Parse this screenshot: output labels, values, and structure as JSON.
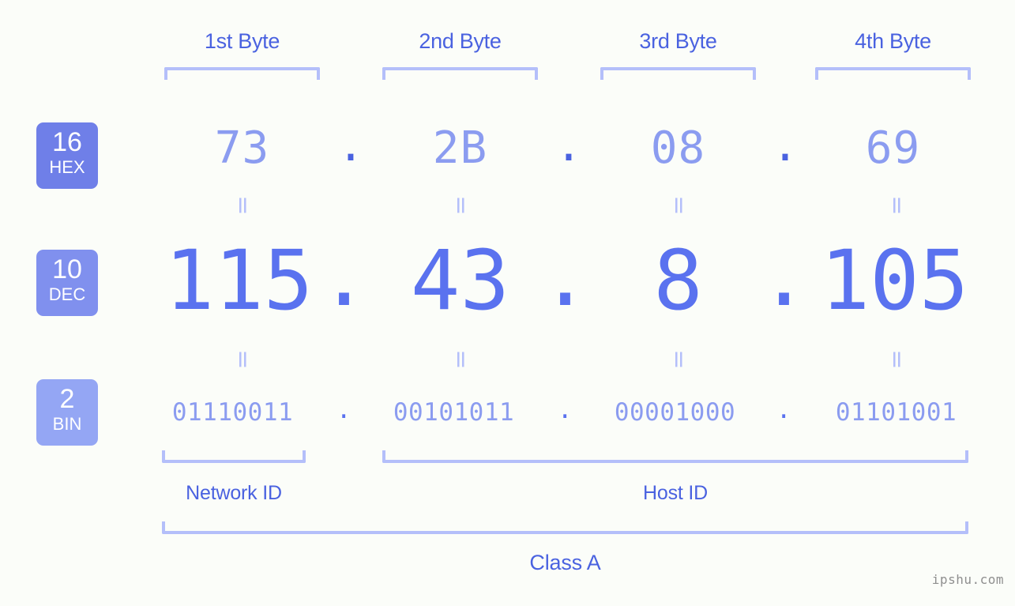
{
  "background_color": "#fbfdf9",
  "accent_colors": {
    "badge_hex": "#6f7fe8",
    "badge_dec": "#8090ee",
    "badge_bin": "#94a6f4",
    "bracket": "#b4bffa",
    "label_blue": "#4a62e0",
    "value_light": "#8b9cf0",
    "value_strong": "#5a72ef"
  },
  "byte_headers": [
    {
      "label": "1st Byte"
    },
    {
      "label": "2nd Byte"
    },
    {
      "label": "3rd Byte"
    },
    {
      "label": "4th Byte"
    }
  ],
  "bases": [
    {
      "number": "16",
      "system": "HEX"
    },
    {
      "number": "10",
      "system": "DEC"
    },
    {
      "number": "2",
      "system": "BIN"
    }
  ],
  "rows": {
    "hex": {
      "values": [
        "73",
        "2B",
        "08",
        "69"
      ],
      "separator": "."
    },
    "dec": {
      "values": [
        "115",
        "43",
        "8",
        "105"
      ],
      "separator": "."
    },
    "bin": {
      "values": [
        "01110011",
        "00101011",
        "00001000",
        "01101001"
      ],
      "separator": "."
    }
  },
  "equals_symbol": "=",
  "segments": {
    "network": {
      "label": "Network ID"
    },
    "host": {
      "label": "Host ID"
    },
    "class": {
      "label": "Class A"
    }
  },
  "watermark": "ipshu.com"
}
